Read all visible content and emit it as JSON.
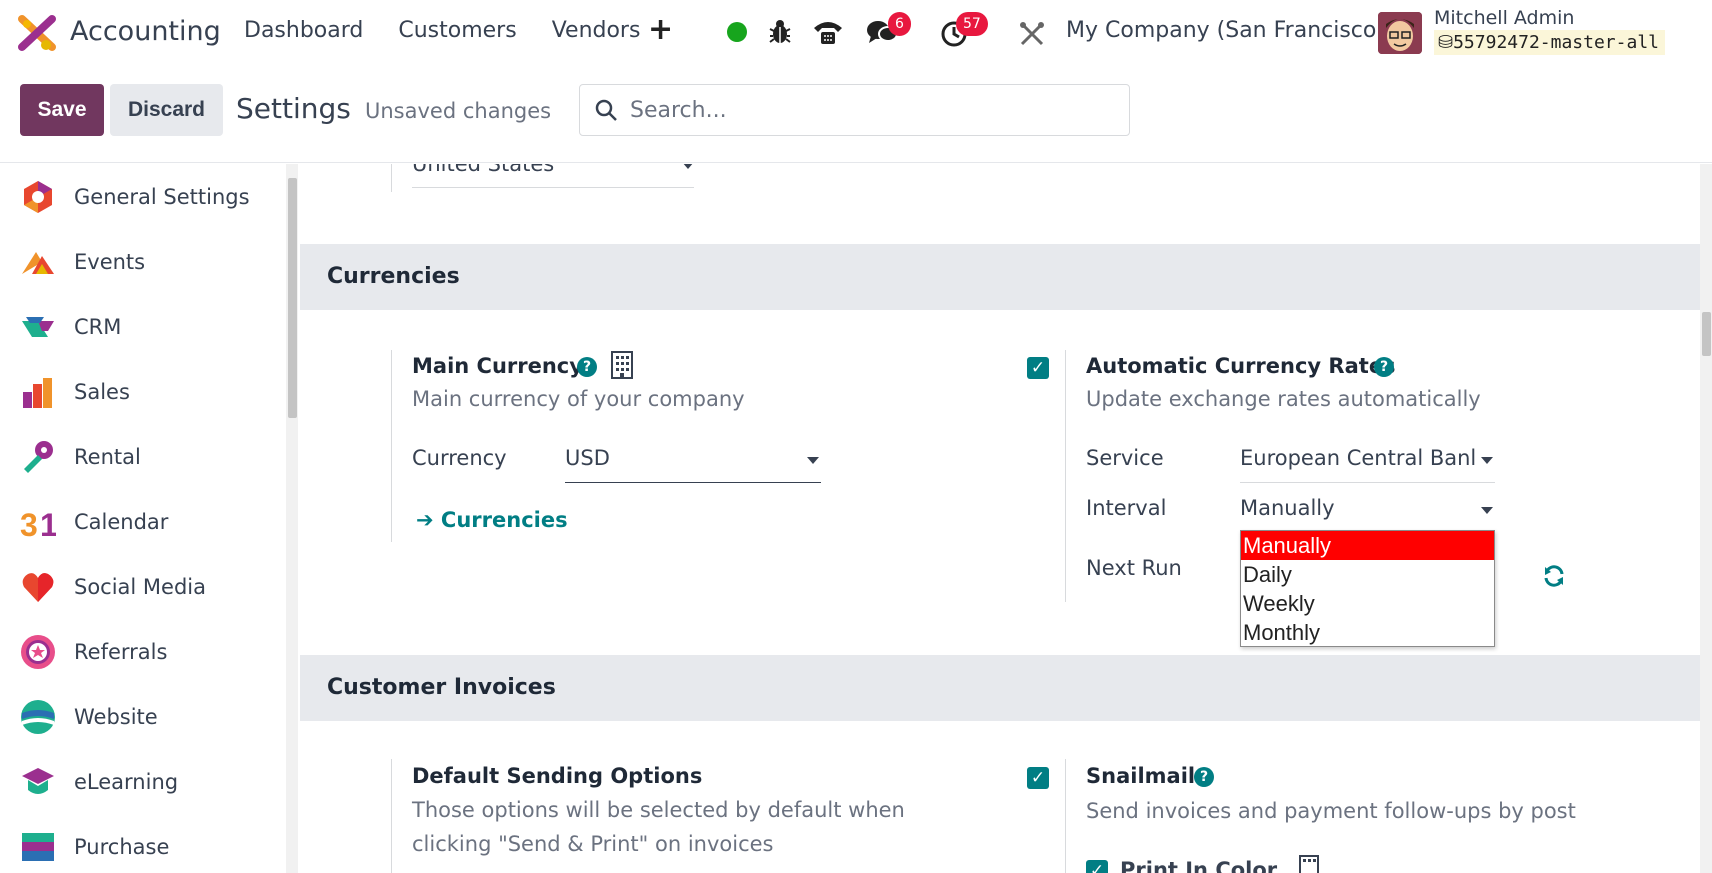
{
  "navbar": {
    "app_name": "Accounting",
    "menu": [
      "Dashboard",
      "Customers",
      "Vendors"
    ],
    "plus_label": "+",
    "chat_badge": "6",
    "activity_badge": "57",
    "company": "My Company (San Francisco)",
    "user_name": "Mitchell Admin",
    "db_name": "55792472-master-all"
  },
  "control": {
    "save_label": "Save",
    "discard_label": "Discard",
    "breadcrumb": "Settings",
    "status": "Unsaved changes",
    "search_placeholder": "Search..."
  },
  "sidebar": {
    "items": [
      {
        "label": "General Settings",
        "icon": "general-settings-icon"
      },
      {
        "label": "Events",
        "icon": "events-icon"
      },
      {
        "label": "CRM",
        "icon": "crm-icon"
      },
      {
        "label": "Sales",
        "icon": "sales-icon"
      },
      {
        "label": "Rental",
        "icon": "rental-icon"
      },
      {
        "label": "Calendar",
        "icon": "calendar-icon"
      },
      {
        "label": "Social Media",
        "icon": "social-media-icon"
      },
      {
        "label": "Referrals",
        "icon": "referrals-icon"
      },
      {
        "label": "Website",
        "icon": "website-icon"
      },
      {
        "label": "eLearning",
        "icon": "elearning-icon"
      },
      {
        "label": "Purchase",
        "icon": "purchase-icon"
      }
    ]
  },
  "main": {
    "country_value": "United States",
    "currencies": {
      "section_title": "Currencies",
      "main_currency_title": "Main Currency",
      "main_currency_desc": "Main currency of your company",
      "currency_label": "Currency",
      "currency_value": "USD",
      "currencies_link": "Currencies",
      "auto_rates_title": "Automatic Currency Rates",
      "auto_rates_desc": "Update exchange rates automatically",
      "service_label": "Service",
      "service_value": "European Central Banl",
      "interval_label": "Interval",
      "interval_value": "Manually",
      "next_run_label": "Next Run",
      "interval_options": [
        "Manually",
        "Daily",
        "Weekly",
        "Monthly"
      ],
      "selected_option": "Manually"
    },
    "invoices": {
      "section_title": "Customer Invoices",
      "default_sending_title": "Default Sending Options",
      "default_sending_desc_1": "Those options will be selected by default when",
      "default_sending_desc_2": "clicking \"Send & Print\" on invoices",
      "snailmail_title": "Snailmail",
      "snailmail_desc": "Send invoices and payment follow-ups by post",
      "print_in_color": "Print In Color"
    }
  },
  "colors": {
    "brand_purple": "#71375f",
    "teal": "#017e84",
    "badge_red": "#e8183f",
    "selected_option": "#ff0000"
  }
}
